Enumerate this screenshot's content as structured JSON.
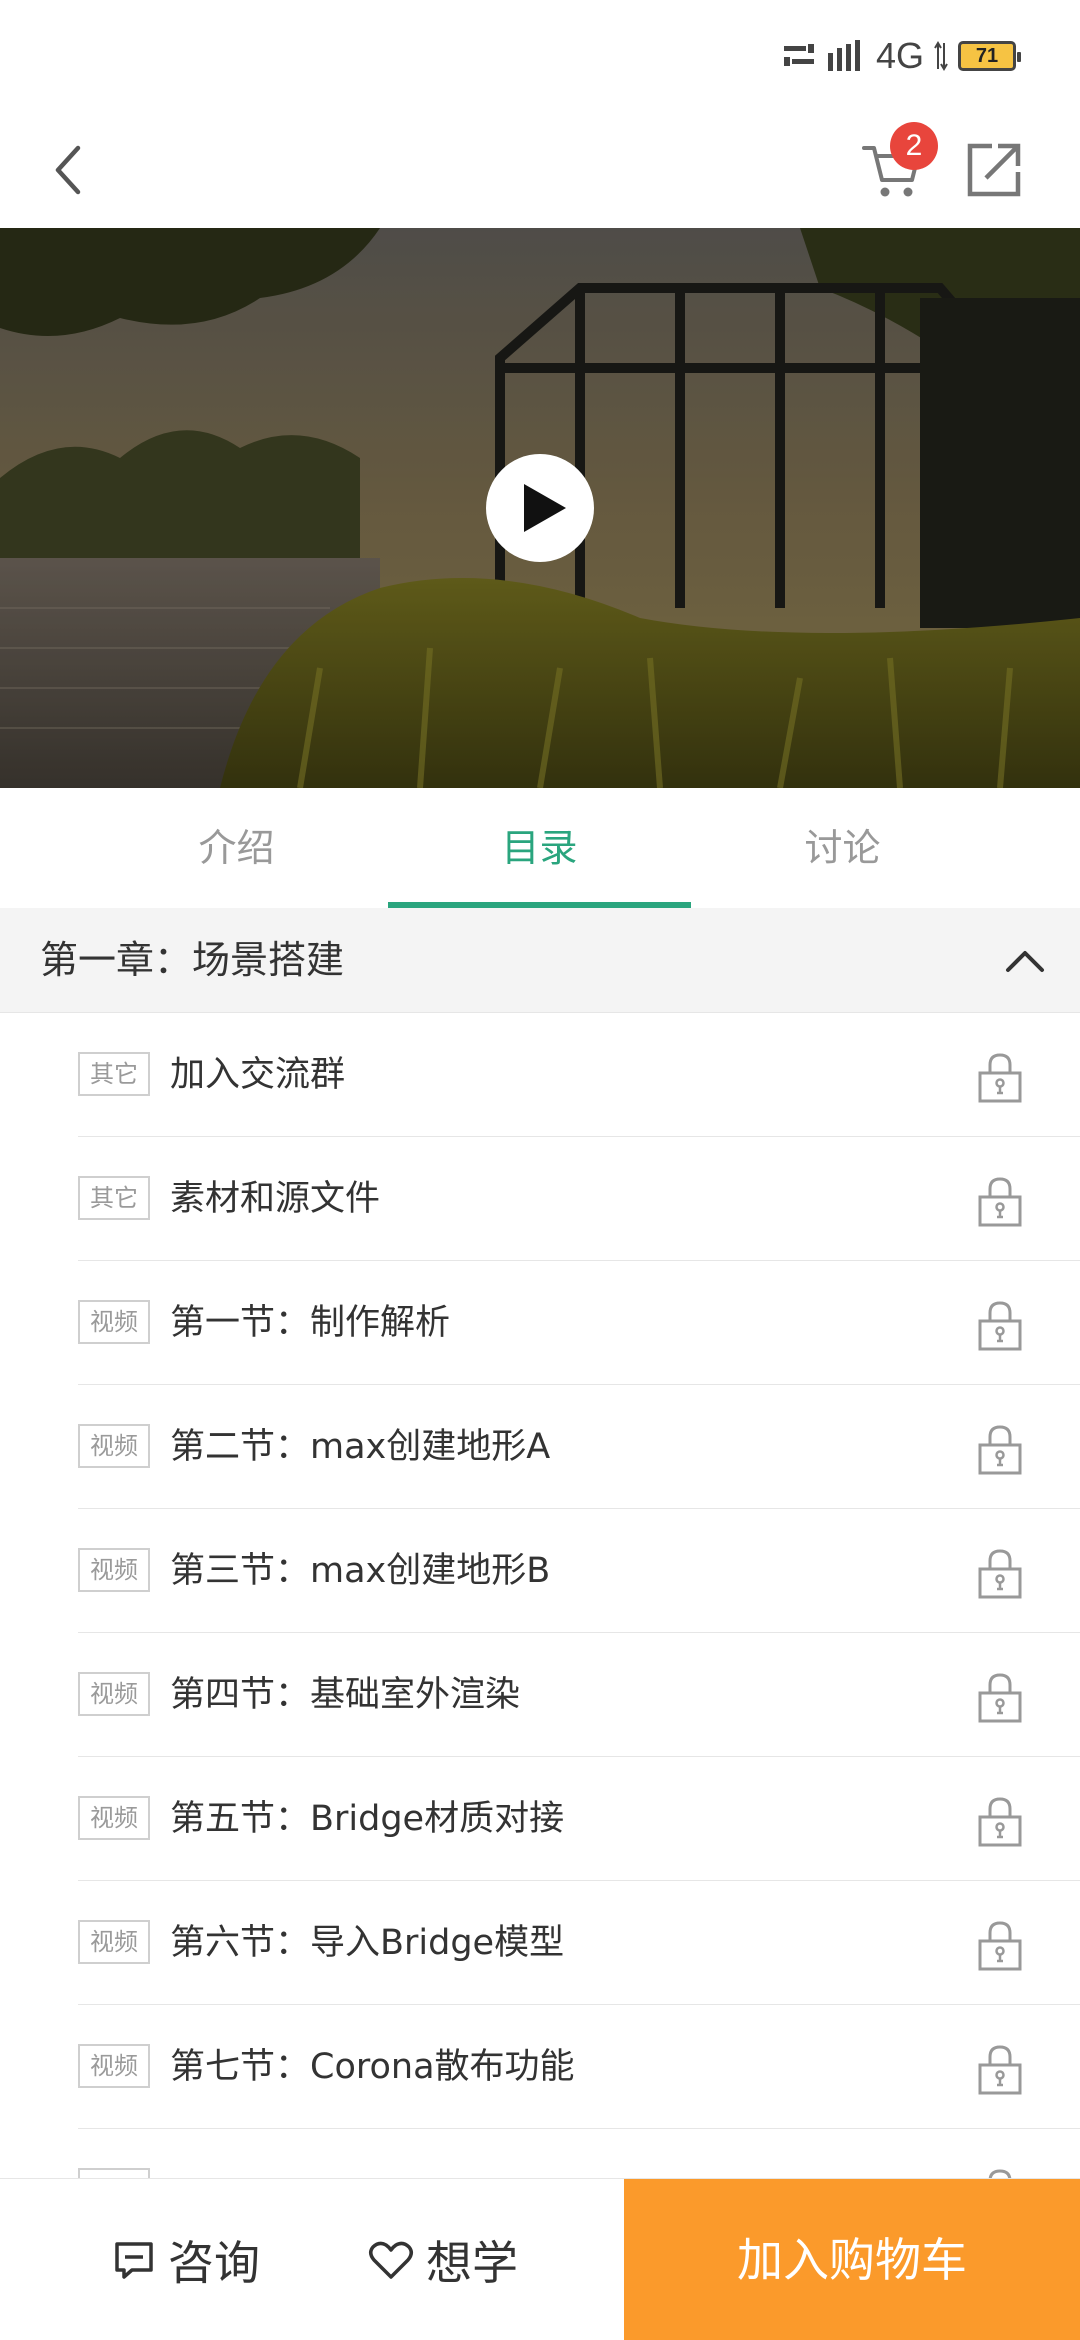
{
  "status_bar": {
    "network": "4G",
    "battery": "71"
  },
  "nav": {
    "cart_count": "2"
  },
  "tabs": [
    {
      "label": "介绍",
      "active": false
    },
    {
      "label": "目录",
      "active": true
    },
    {
      "label": "讨论",
      "active": false
    }
  ],
  "chapter": {
    "title": "第一章：场景搭建",
    "expanded": true
  },
  "lessons": [
    {
      "tag": "其它",
      "title": "加入交流群",
      "locked": true
    },
    {
      "tag": "其它",
      "title": "素材和源文件",
      "locked": true
    },
    {
      "tag": "视频",
      "title": "第一节：制作解析",
      "locked": true
    },
    {
      "tag": "视频",
      "title": "第二节：max创建地形A",
      "locked": true
    },
    {
      "tag": "视频",
      "title": "第三节：max创建地形B",
      "locked": true
    },
    {
      "tag": "视频",
      "title": "第四节：基础室外渲染",
      "locked": true
    },
    {
      "tag": "视频",
      "title": "第五节：Bridge材质对接",
      "locked": true
    },
    {
      "tag": "视频",
      "title": "第六节：导入Bridge模型",
      "locked": true
    },
    {
      "tag": "视频",
      "title": "第七节：Corona散布功能",
      "locked": true
    }
  ],
  "bottom_bar": {
    "consult_label": "咨询",
    "wish_label": "想学",
    "add_cart_label": "加入购物车"
  },
  "colors": {
    "accent": "#2aa57e",
    "cta": "#fb9a2b",
    "badge": "#e8453c"
  }
}
